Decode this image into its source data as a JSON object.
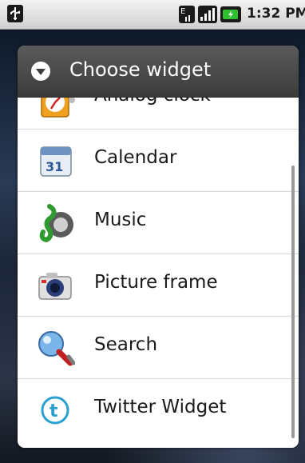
{
  "status_bar": {
    "time": "1:32 PM",
    "icons": [
      "usb-icon",
      "sim-icon",
      "signal-icon",
      "battery-charging-icon"
    ]
  },
  "dialog": {
    "title": "Choose widget",
    "title_icon": "dropdown-arrow-icon",
    "items": [
      {
        "label": "Analog clock",
        "icon": "analog-clock-icon"
      },
      {
        "label": "Calendar",
        "icon": "calendar-icon",
        "icon_text": "31"
      },
      {
        "label": "Music",
        "icon": "music-icon"
      },
      {
        "label": "Picture frame",
        "icon": "camera-icon"
      },
      {
        "label": "Search",
        "icon": "search-icon"
      },
      {
        "label": "Twitter Widget",
        "icon": "twitter-icon",
        "icon_text": "t"
      }
    ]
  },
  "colors": {
    "header_bg": "#444444",
    "list_bg": "#ffffff",
    "divider": "#d8d8d8",
    "battery_green": "#2ec02e"
  }
}
